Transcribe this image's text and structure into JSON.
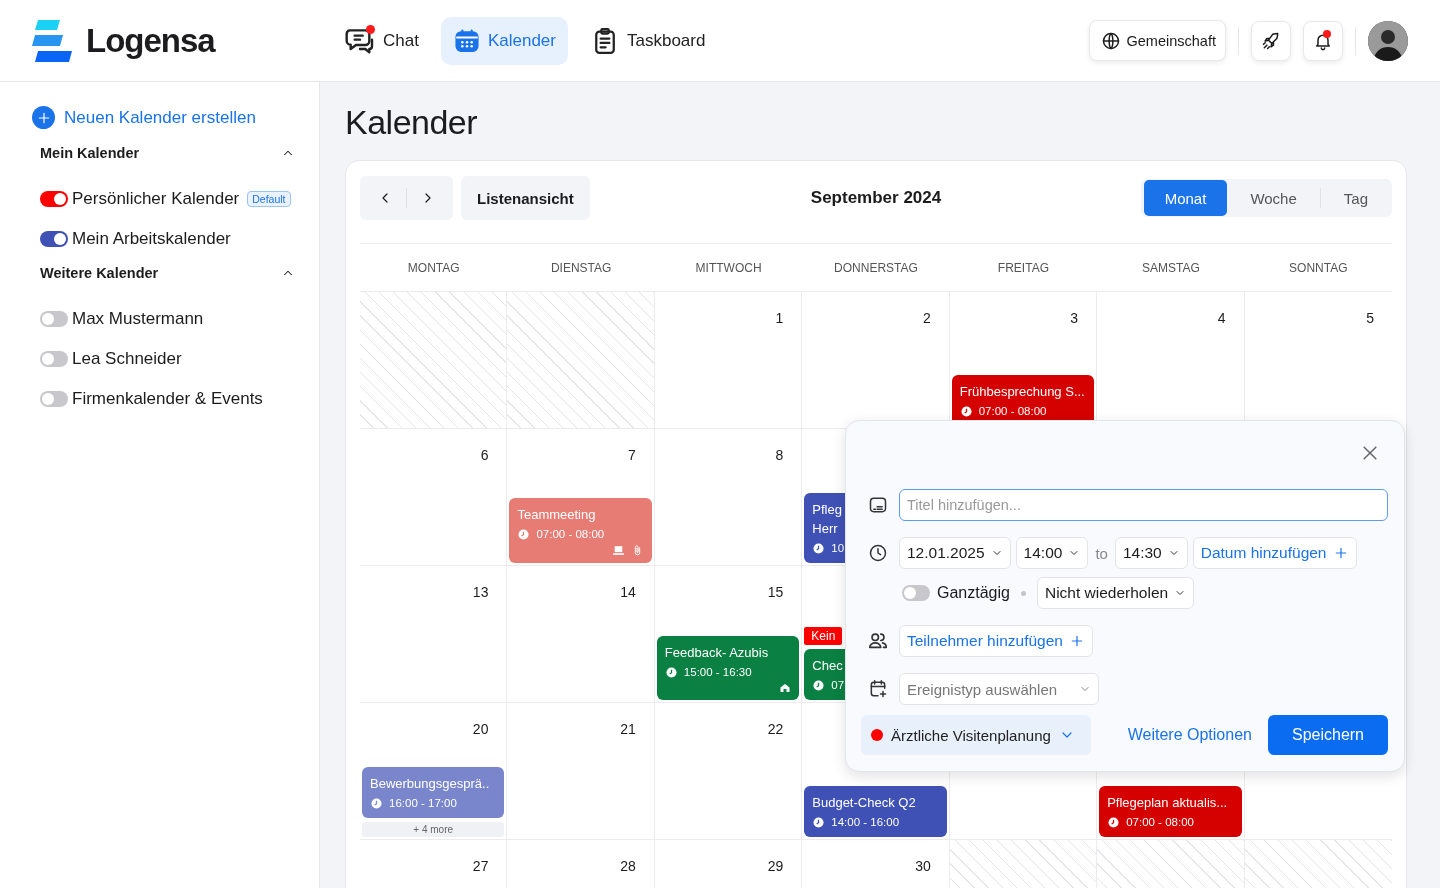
{
  "header": {
    "logo": "Logensa",
    "nav": [
      {
        "label": "Chat",
        "selected": false,
        "unread": true
      },
      {
        "label": "Kalender",
        "selected": true,
        "unread": false
      },
      {
        "label": "Taskboard",
        "selected": false,
        "unread": false
      }
    ],
    "community": "Gemeinschaft",
    "bell_unread": true
  },
  "sidebar": {
    "create": "Neuen Kalender erstellen",
    "sections": [
      {
        "title": "Mein Kalender",
        "expanded": true,
        "calendars": [
          {
            "label": "Persönlicher Kalender",
            "on": true,
            "color": "#ff0000",
            "badge": "Default"
          },
          {
            "label": "Mein Arbeitskalender",
            "on": true,
            "color": "#3f51b5"
          }
        ]
      },
      {
        "title": "Weitere Kalender",
        "expanded": true,
        "calendars": [
          {
            "label": "Max Mustermann",
            "on": false
          },
          {
            "label": "Lea Schneider",
            "on": false
          },
          {
            "label": "Firmenkalender & Events",
            "on": false
          }
        ]
      }
    ]
  },
  "main": {
    "title": "Kalender",
    "toolbar": {
      "list_view": "Listenansicht",
      "month": "September 2024",
      "views": [
        {
          "label": "Monat",
          "selected": true
        },
        {
          "label": "Woche",
          "selected": false
        },
        {
          "label": "Tag",
          "selected": false
        }
      ]
    },
    "weekdays": [
      "MONTAG",
      "DIENSTAG",
      "MITTWOCH",
      "DONNERSTAG",
      "FREITAG",
      "SAMSTAG",
      "SONNTAG"
    ],
    "weeks": [
      {
        "days": [
          {
            "outside": true
          },
          {
            "outside": true
          },
          {
            "outside": false,
            "date": "1"
          },
          {
            "outside": false,
            "date": "2"
          },
          {
            "outside": false,
            "date": "3",
            "events": [
              {
                "kind": "event",
                "title_lines": [
                  "Frühbesprechung S..."
                ],
                "time": "07:00 - 08:00",
                "color": "#d50000"
              }
            ]
          },
          {
            "outside": false,
            "date": "4"
          },
          {
            "outside": false,
            "date": "5"
          }
        ]
      },
      {
        "days": [
          {
            "outside": false,
            "date": "6"
          },
          {
            "outside": false,
            "date": "7",
            "events": [
              {
                "kind": "event",
                "title_lines": [
                  "Teammeeting"
                ],
                "time": "07:00 - 08:00",
                "color": "#e67c73",
                "online": true,
                "attachment": true
              }
            ]
          },
          {
            "outside": false,
            "date": "8"
          },
          {
            "outside": false,
            "events": [
              {
                "kind": "event",
                "title_lines": [
                  "Pfleg",
                  "Herr"
                ],
                "time": "10",
                "color": "#3f51b5"
              }
            ]
          }
        ]
      },
      {
        "days": [
          {
            "outside": false,
            "date": "13"
          },
          {
            "outside": false,
            "date": "14"
          },
          {
            "outside": false,
            "date": "15",
            "events": [
              {
                "kind": "event",
                "title_lines": [
                  "Feedback- Azubis"
                ],
                "time": "15:00 - 16:30",
                "color": "#0b8043",
                "onsite": true
              }
            ]
          },
          {
            "outside": false,
            "events": [
              {
                "kind": "tag",
                "title_lines": [
                  "Kein"
                ],
                "color": "#ff0000"
              },
              {
                "kind": "event",
                "title_lines": [
                  "Chec"
                ],
                "time": "07",
                "color": "#0b8043"
              }
            ]
          }
        ]
      },
      {
        "days": [
          {
            "outside": false,
            "date": "20",
            "events": [
              {
                "kind": "event",
                "title_lines": [
                  "Bewerbungsgesprä.."
                ],
                "time": "16:00 - 17:00",
                "color": "#7986cb"
              }
            ],
            "more": "+ 4 more"
          },
          {
            "outside": false,
            "date": "21"
          },
          {
            "outside": false,
            "date": "22"
          },
          {
            "outside": false,
            "events": [
              {
                "kind": "event",
                "title_lines": [
                  "Budget-Check Q2"
                ],
                "time": "14:00 - 16:00",
                "color": "#3f51b5"
              }
            ]
          },
          {
            "outside": false
          },
          {
            "outside": false,
            "events": [
              {
                "kind": "event",
                "title_lines": [
                  "Pflegeplan aktualis..."
                ],
                "time": "07:00 - 08:00",
                "color": "#d50000"
              }
            ]
          },
          {
            "outside": false
          }
        ]
      },
      {
        "days": [
          {
            "outside": false,
            "date": "27"
          },
          {
            "outside": false,
            "date": "28"
          },
          {
            "outside": false,
            "date": "29"
          },
          {
            "outside": false,
            "date": "30"
          },
          {
            "outside": true
          },
          {
            "outside": true
          },
          {
            "outside": true
          }
        ]
      }
    ]
  },
  "popup": {
    "title_placeholder": "Titel hinzufügen...",
    "date": "12.01.2025",
    "start": "14:00",
    "to": "to",
    "end": "14:30",
    "add_date": "Datum hinzufügen",
    "all_day": {
      "label": "Ganztägig",
      "on": false
    },
    "repeat": "Nicht wiederholen",
    "add_participants": "Teilnehmer hinzufügen",
    "event_type_placeholder": "Ereignistyp auswählen",
    "calendar": "Ärztliche Visitenplanung",
    "more_options": "Weitere Optionen",
    "save": "Speichern"
  }
}
